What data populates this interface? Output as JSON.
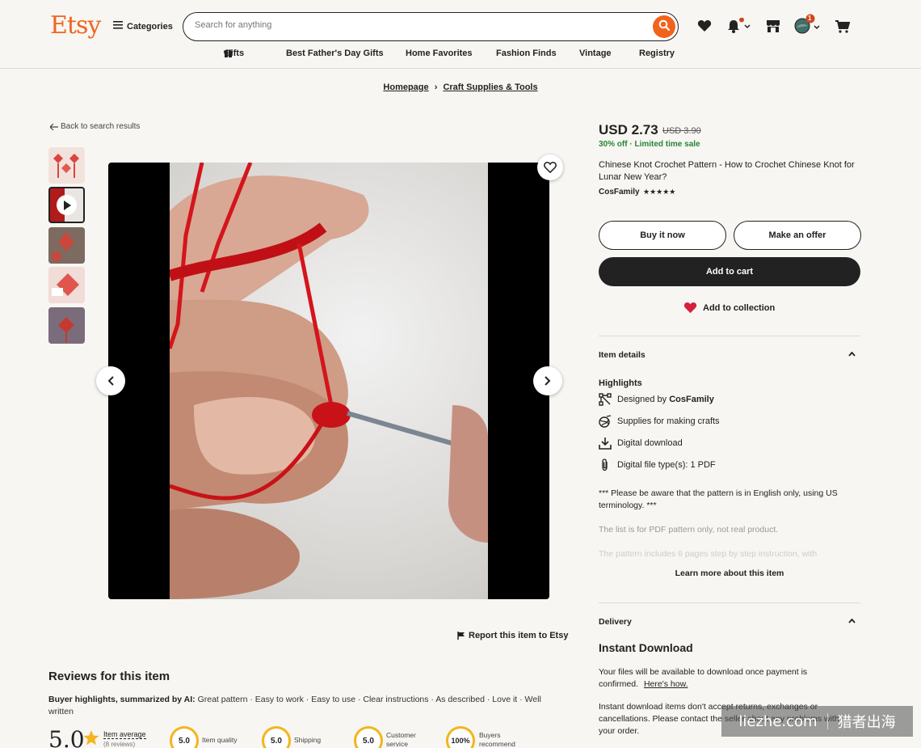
{
  "header": {
    "logo": "Etsy",
    "categories_label": "Categories",
    "search_placeholder": "Search for anything",
    "notification_count": "1"
  },
  "nav": {
    "gifts": "Gifts",
    "fathers_day": "Best Father's Day Gifts",
    "home_favorites": "Home Favorites",
    "fashion_finds": "Fashion Finds",
    "vintage": "Vintage",
    "registry": "Registry"
  },
  "breadcrumb": {
    "home": "Homepage",
    "sep": "›",
    "category": "Craft Supplies & Tools"
  },
  "back_label": "Back to search results",
  "report_label": "Report this item to Etsy",
  "product": {
    "price": "USD 2.73",
    "old_price": "USD 3.90",
    "discount": "30% off",
    "sale_sep": "·",
    "sale_label": "Limited time sale",
    "title": "Chinese Knot Crochet Pattern - How to Crochet Chinese Knot for Lunar New Year?",
    "shop": "CosFamily",
    "stars": "★★★★★",
    "buy_now": "Buy it now",
    "make_offer": "Make an offer",
    "add_to_cart": "Add to cart",
    "add_collection": "Add to collection"
  },
  "item_details": {
    "heading": "Item details",
    "highlights_heading": "Highlights",
    "designed_by_prefix": "Designed by",
    "designed_by_shop": "CosFamily",
    "supplies": "Supplies for making crafts",
    "digital_download": "Digital download",
    "file_type": "Digital file type(s): 1 PDF",
    "desc1": "*** Please be aware that the pattern is in English only, using US terminology. ***",
    "desc2": "The list is for PDF pattern only, not real product.",
    "desc3": "The pattern includes 6 pages step by step instruction, with",
    "learn_more": "Learn more about this item"
  },
  "delivery": {
    "heading": "Delivery",
    "instant_title": "Instant Download",
    "files_text": "Your files will be available to download once payment is confirmed.",
    "heres_how": "Here's how.",
    "returns_text": "Instant download items don't accept returns, exchanges or cancellations. Please contact the seller about any problems with your order."
  },
  "reviews": {
    "title": "Reviews for this item",
    "ai_label": "Buyer highlights, summarized by AI:",
    "ai_tags": "Great pattern · Easy to work · Easy to use · Clear instructions · As described · Love it · Well written",
    "average": "5.0",
    "item_average": "Item average",
    "review_count": "(8 reviews)",
    "item_quality_score": "5.0",
    "item_quality_label": "Item quality",
    "shipping_score": "5.0",
    "shipping_label": "Shipping",
    "customer_service_score": "5.0",
    "customer_service_label": "Customer service",
    "buyers_recommend_score": "100%",
    "buyers_recommend_label": "Buyers recommend"
  },
  "watermark": {
    "left": "liezhe.com",
    "right": "猎者出海"
  },
  "colors": {
    "brand": "#f1641e",
    "sale_green": "#258635",
    "dark_button": "#222222",
    "heart_red": "#d6213b",
    "badge_yellow": "#f3b51d"
  },
  "icons": [
    "hamburger-icon",
    "search-icon",
    "heart-icon",
    "bell-icon",
    "shop-icon",
    "avatar",
    "cart-icon",
    "gift-icon",
    "arrow-left-icon",
    "play-icon",
    "chevron-left-icon",
    "chevron-right-icon",
    "flag-icon",
    "star-icon",
    "designer-icon",
    "supplies-icon",
    "download-icon",
    "paperclip-icon",
    "chevron-up-icon"
  ]
}
